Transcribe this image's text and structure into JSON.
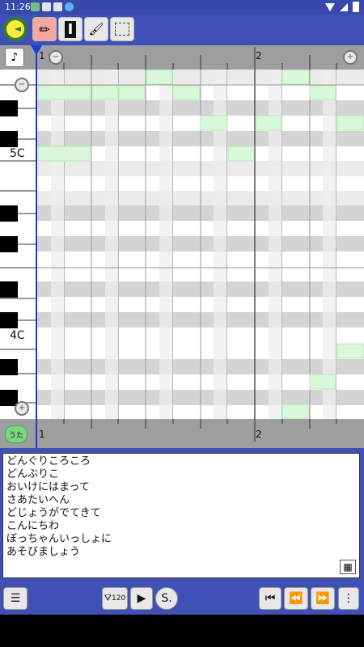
{
  "status_bar": {
    "time": "11:26"
  },
  "toolbar": {
    "tools": [
      {
        "name": "pencil-tool",
        "glyph": "✏",
        "selected": true
      },
      {
        "name": "text-tool",
        "glyph": "I",
        "selected": false
      },
      {
        "name": "paint-tool",
        "glyph": "🖌",
        "selected": false
      },
      {
        "name": "select-tool",
        "glyph": "⬚",
        "selected": false
      }
    ]
  },
  "ruler": {
    "marker_1": "1",
    "marker_2": "2"
  },
  "keyboard": {
    "label_5c": "5C",
    "label_4c": "4C"
  },
  "uta_button": {
    "label": "うた"
  },
  "lyrics": {
    "text": "どんぐりころころ\nどんぶりこ\nおいけにはまって\nさあたいへん\nどじょうがでてきて\nこんにちわ\nぼっちゃんいっしょに\nあそびましょう"
  },
  "bottom_bar": {
    "tempo_label": "120",
    "play_glyph": "▶",
    "s_label": "S.",
    "first_glyph": "⏮",
    "rewind_glyph": "⏪",
    "forward_glyph": "⏩",
    "more_glyph": "⋮",
    "menu_glyph": "☰"
  },
  "colors": {
    "accent": "#3f51b5",
    "note": "#d9f7d9",
    "playhead": "#1a3be0"
  }
}
